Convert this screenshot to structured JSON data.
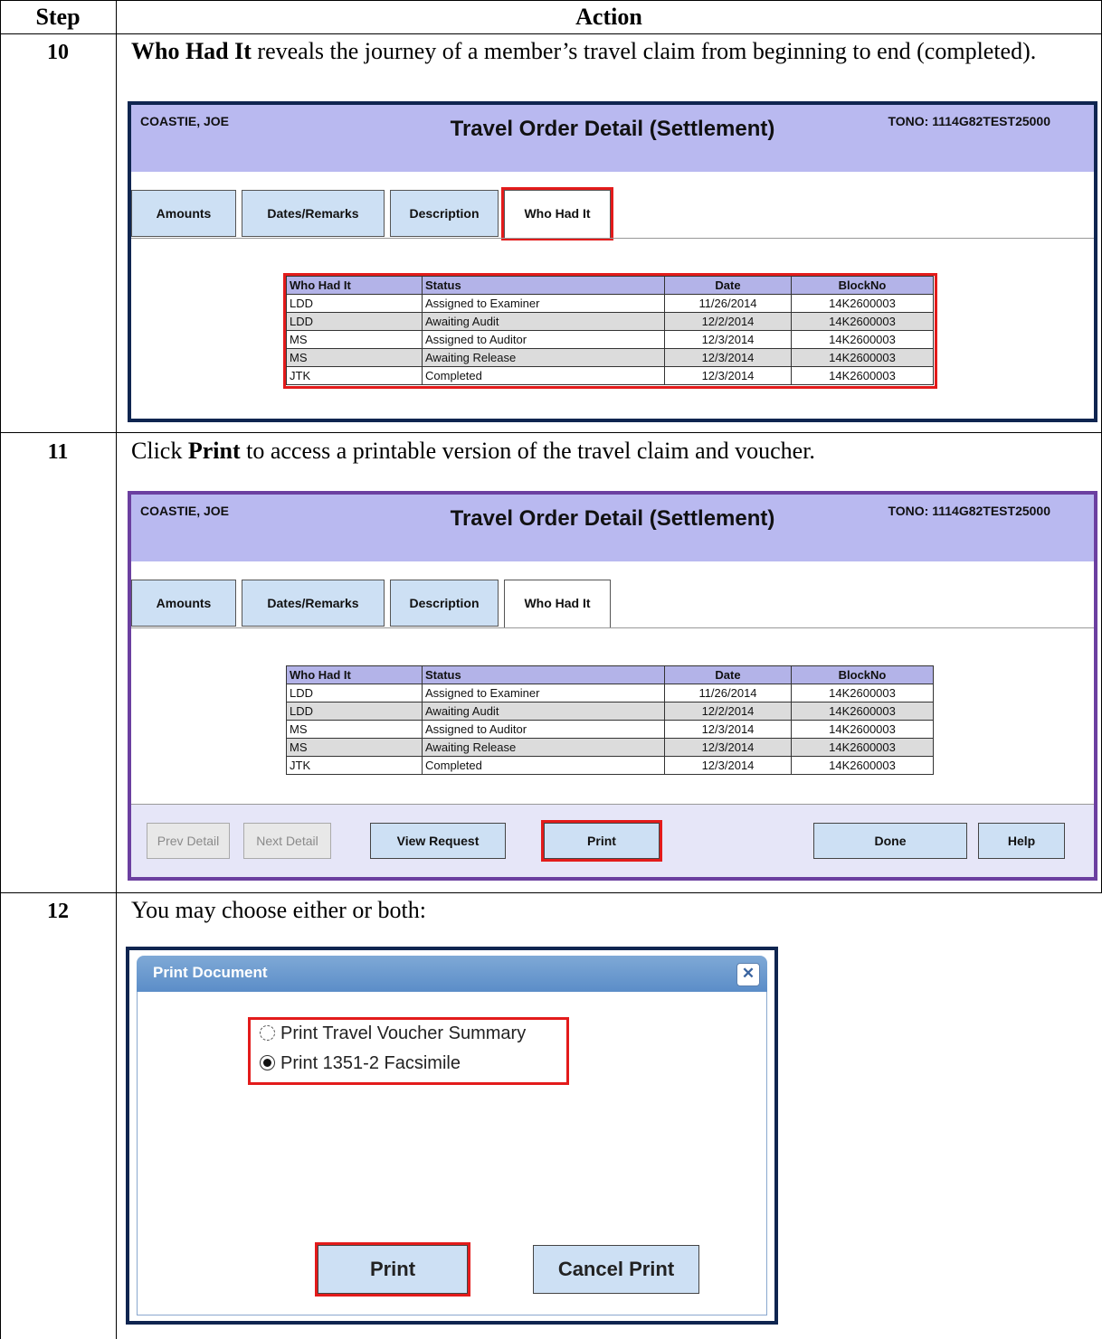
{
  "table_header": {
    "step": "Step",
    "action": "Action"
  },
  "steps": [
    {
      "number": "10",
      "bold": "Who Had It",
      "text": " reveals the journey of a member’s travel claim from beginning to end (completed)."
    },
    {
      "number": "11",
      "pre": "Click ",
      "bold": "Print",
      "text": " to access a printable version of the travel claim and voucher."
    },
    {
      "number": "12",
      "text": "You may choose either or both:"
    }
  ],
  "app": {
    "member": "COASTIE, JOE",
    "title": "Travel Order Detail (Settlement)",
    "tono": "TONO: 1114G82TEST25000",
    "tabs": [
      "Amounts",
      "Dates/Remarks",
      "Description",
      "Who Had It"
    ],
    "columns": [
      "Who Had It",
      "Status",
      "Date",
      "BlockNo"
    ],
    "rows": [
      [
        "LDD",
        "Assigned to Examiner",
        "11/26/2014",
        "14K2600003"
      ],
      [
        "LDD",
        "Awaiting Audit",
        "12/2/2014",
        "14K2600003"
      ],
      [
        "MS",
        "Assigned to Auditor",
        "12/3/2014",
        "14K2600003"
      ],
      [
        "MS",
        "Awaiting Release",
        "12/3/2014",
        "14K2600003"
      ],
      [
        "JTK",
        "Completed",
        "12/3/2014",
        "14K2600003"
      ]
    ],
    "footer_buttons": {
      "prev": "Prev Detail",
      "next": "Next Detail",
      "view_request": "View Request",
      "print": "Print",
      "done": "Done",
      "help": "Help"
    }
  },
  "dialog": {
    "title": "Print Document",
    "close_icon": "close-icon",
    "options": [
      {
        "label": "Print Travel Voucher Summary",
        "selected": false
      },
      {
        "label": "Print 1351-2 Facsimile",
        "selected": true
      }
    ],
    "print_button": "Print",
    "cancel_button": "Cancel Print"
  },
  "colors": {
    "header_band": "#b9b9f0",
    "highlight": "#e31b1b",
    "tab": "#cde0f4",
    "panel1_border": "#0f2550",
    "panel2_border": "#6b3fa0"
  }
}
